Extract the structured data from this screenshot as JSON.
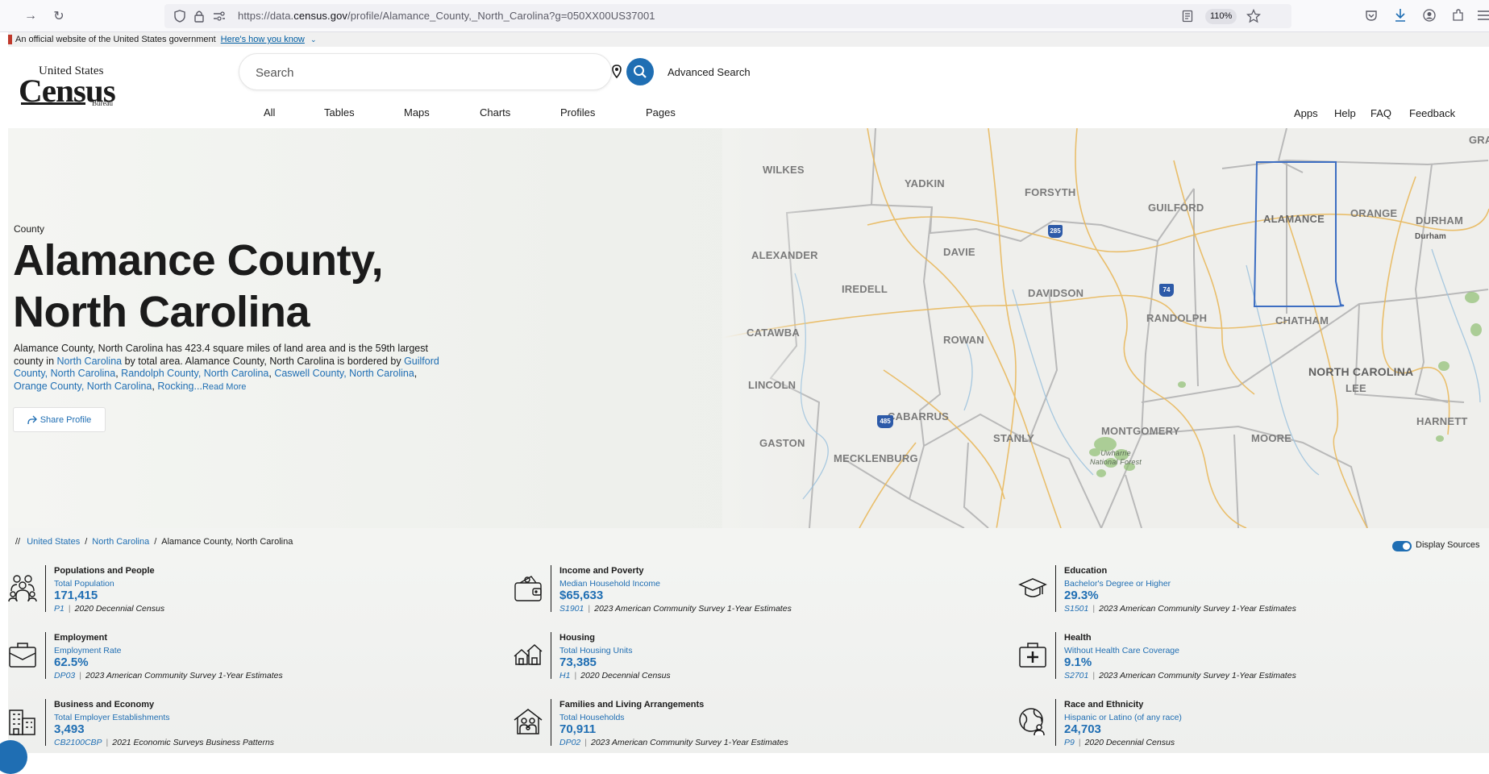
{
  "browser": {
    "url_prefix": "https://data.",
    "url_domain": "census.gov",
    "url_path": "/profile/Alamance_County,_North_Carolina?g=050XX00US37001",
    "zoom": "110%"
  },
  "gov_banner": {
    "text": "An official website of the United States government",
    "link": "Here's how you know"
  },
  "logo": {
    "line1": "United States",
    "line2": "Census",
    "line3": "Bureau"
  },
  "search": {
    "placeholder": "Search",
    "advanced": "Advanced Search"
  },
  "nav_tabs": [
    "All",
    "Tables",
    "Maps",
    "Charts",
    "Profiles",
    "Pages"
  ],
  "utility_links": [
    "Apps",
    "Help",
    "FAQ",
    "Feedback"
  ],
  "hero": {
    "type": "County",
    "title_line1": "Alamance County,",
    "title_line2": "North Carolina",
    "desc_1": "Alamance County, North Carolina has 423.4 square miles of land area and is the 59th largest county in ",
    "desc_link_state": "North Carolina",
    "desc_2": " by total area. Alamance County, North Carolina is bordered by ",
    "desc_link_1": "Guilford County, North Carolina",
    "desc_link_2": "Randolph County, North Carolina",
    "desc_link_3": "Caswell County, North Carolina",
    "desc_link_4": "Orange County, North Carolina",
    "desc_link_5": "Rocking...",
    "read_more": "Read More",
    "share": "Share Profile"
  },
  "map_labels": {
    "wilkes": "WILKES",
    "yadkin": "YADKIN",
    "forsyth": "FORSYTH",
    "guilford": "GUILFORD",
    "alamance": "ALAMANCE",
    "orange": "ORANGE",
    "durham": "DURHAM",
    "durham_city": "Durham",
    "alexander": "ALEXANDER",
    "davie": "DAVIE",
    "iredell": "IREDELL",
    "davidson": "DAVIDSON",
    "randolph": "RANDOLPH",
    "chatham": "CHATHAM",
    "catawba": "CATAWBA",
    "rowan": "ROWAN",
    "north_carolina": "NORTH CAROLINA",
    "lee": "LEE",
    "lincoln": "LINCOLN",
    "cabarrus": "CABARRUS",
    "stanly": "STANLY",
    "montgomery": "MONTGOMERY",
    "moore": "MOORE",
    "harnett": "HARNETT",
    "gaston": "GASTON",
    "mecklenburg": "MECKLENBURG",
    "gra": "GRA",
    "forest": "Uwharrie National Forest",
    "shield_285": "285",
    "shield_74": "74",
    "shield_485": "485"
  },
  "breadcrumb": {
    "prefix": "//",
    "items": [
      "United States",
      "North Carolina",
      "Alamance County, North Carolina"
    ]
  },
  "display_sources": "Display Sources",
  "stats": [
    {
      "category": "Populations and People",
      "label": "Total Population",
      "value": "171,415",
      "code": "P1",
      "source": "2020 Decennial Census",
      "icon": "people-icon"
    },
    {
      "category": "Income and Poverty",
      "label": "Median Household Income",
      "value": "$65,633",
      "code": "S1901",
      "source": "2023 American Community Survey 1-Year Estimates",
      "icon": "wallet-icon"
    },
    {
      "category": "Education",
      "label": "Bachelor's Degree or Higher",
      "value": "29.3%",
      "code": "S1501",
      "source": "2023 American Community Survey 1-Year Estimates",
      "icon": "graduation-cap-icon"
    },
    {
      "category": "Employment",
      "label": "Employment Rate",
      "value": "62.5%",
      "code": "DP03",
      "source": "2023 American Community Survey 1-Year Estimates",
      "icon": "briefcase-icon"
    },
    {
      "category": "Housing",
      "label": "Total Housing Units",
      "value": "73,385",
      "code": "H1",
      "source": "2020 Decennial Census",
      "icon": "houses-icon"
    },
    {
      "category": "Health",
      "label": "Without Health Care Coverage",
      "value": "9.1%",
      "code": "S2701",
      "source": "2023 American Community Survey 1-Year Estimates",
      "icon": "medical-kit-icon"
    },
    {
      "category": "Business and Economy",
      "label": "Total Employer Establishments",
      "value": "3,493",
      "code": "CB2100CBP",
      "source": "2021 Economic Surveys Business Patterns",
      "icon": "buildings-icon"
    },
    {
      "category": "Families and Living Arrangements",
      "label": "Total Households",
      "value": "70,911",
      "code": "DP02",
      "source": "2023 American Community Survey 1-Year Estimates",
      "icon": "family-home-icon"
    },
    {
      "category": "Race and Ethnicity",
      "label": "Hispanic or Latino (of any race)",
      "value": "24,703",
      "code": "P9",
      "source": "2020 Decennial Census",
      "icon": "globe-people-icon"
    }
  ]
}
